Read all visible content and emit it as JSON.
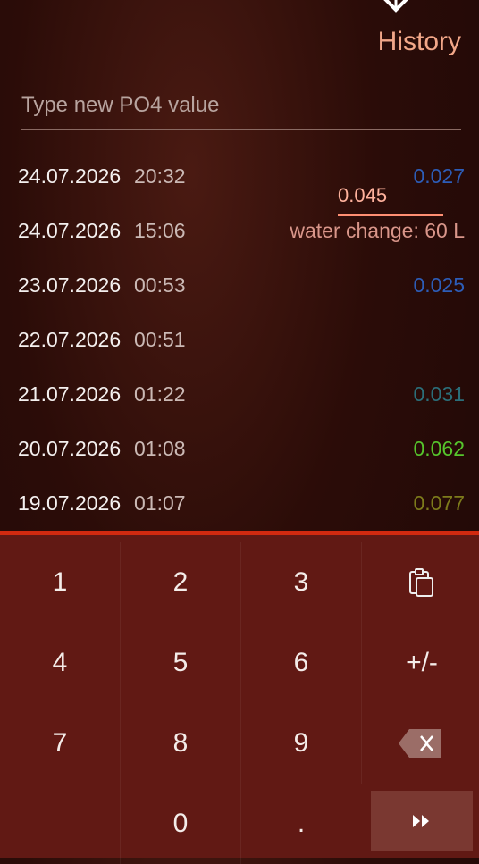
{
  "header": {
    "title": "History"
  },
  "input": {
    "placeholder": "Type new PO4 value"
  },
  "records": [
    {
      "date": "24.07.2026",
      "time": "20:32",
      "value": "0.027",
      "color": "#2d5db8"
    },
    {
      "date": "24.07.2026",
      "time": "15:06",
      "value": "water change: 60 L",
      "color": "#d9968a"
    },
    {
      "date": "23.07.2026",
      "time": "00:53",
      "value": "0.025",
      "color": "#2d5db8"
    },
    {
      "date": "22.07.2026",
      "time": "00:51",
      "value": "",
      "color": "#ffb29d"
    },
    {
      "date": "21.07.2026",
      "time": "01:22",
      "value": "0.031",
      "color": "#2b6f7a"
    },
    {
      "date": "20.07.2026",
      "time": "01:08",
      "value": "0.062",
      "color": "#56c52c"
    },
    {
      "date": "19.07.2026",
      "time": "01:07",
      "value": "0.077",
      "color": "#7d7b1b"
    }
  ],
  "editing": {
    "value": "0.045"
  },
  "keypad": {
    "k1": "1",
    "k2": "2",
    "k3": "3",
    "k4": "4",
    "k5": "5",
    "k6": "6",
    "kpm": "+/-",
    "k7": "7",
    "k8": "8",
    "k9": "9",
    "k0": "0",
    "kdot": "."
  }
}
